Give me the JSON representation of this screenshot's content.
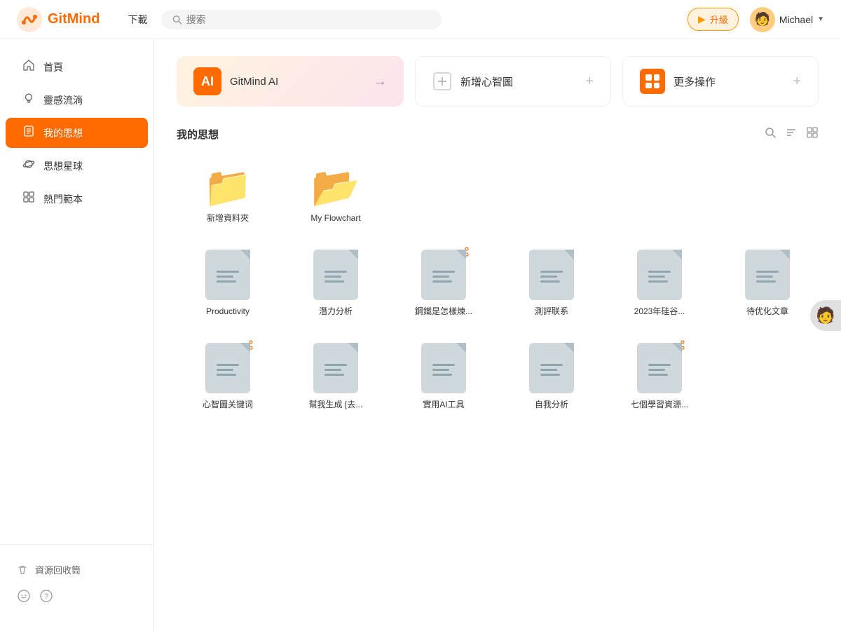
{
  "header": {
    "logo_text": "GitMind",
    "nav_download": "下載",
    "search_placeholder": "搜索",
    "upgrade_label": "升級",
    "user_name": "Michael"
  },
  "sidebar": {
    "items": [
      {
        "id": "home",
        "label": "首頁",
        "icon": "home"
      },
      {
        "id": "inspiration",
        "label": "靈感流淌",
        "icon": "bulb"
      },
      {
        "id": "my-thoughts",
        "label": "我的思想",
        "icon": "doc",
        "active": true
      },
      {
        "id": "planet",
        "label": "思想星球",
        "icon": "planet"
      },
      {
        "id": "templates",
        "label": "熱門範本",
        "icon": "template"
      }
    ],
    "bottom_items": [
      {
        "id": "recycle",
        "label": "資源回收筒",
        "icon": "trash"
      },
      {
        "id": "discord",
        "label": "",
        "icon": "discord"
      },
      {
        "id": "help",
        "label": "",
        "icon": "help"
      }
    ]
  },
  "quick_actions": [
    {
      "id": "gitmind-ai",
      "label": "GitMind AI",
      "type": "ai",
      "icon_text": "AI"
    },
    {
      "id": "new-mindmap",
      "label": "新增心智圖",
      "type": "new"
    },
    {
      "id": "more-actions",
      "label": "更多操作",
      "type": "more"
    }
  ],
  "section": {
    "title": "我的思想",
    "actions": [
      "search",
      "sort",
      "grid"
    ]
  },
  "folders": [
    {
      "id": "new-folder",
      "label": "新增資料夾",
      "color": "#ffa726"
    },
    {
      "id": "my-flowchart",
      "label": "My Flowchart",
      "color": "#ffa726"
    }
  ],
  "files_row1": [
    {
      "id": "productivity",
      "label": "Productivity",
      "shared": false
    },
    {
      "id": "potential-analysis",
      "label": "潛力分析",
      "shared": false
    },
    {
      "id": "steel",
      "label": "鋼鐵是怎樣煉...",
      "shared": true
    },
    {
      "id": "review",
      "label": "測評联系",
      "shared": false
    },
    {
      "id": "silicon-valley",
      "label": "2023年硅谷...",
      "shared": false
    },
    {
      "id": "pending-articles",
      "label": "待优化文章",
      "shared": false
    }
  ],
  "files_row2": [
    {
      "id": "mindmap-keywords",
      "label": "心智圖关键词",
      "shared": true
    },
    {
      "id": "help-generate",
      "label": "幫我生成 [去...",
      "shared": false
    },
    {
      "id": "useful-ai",
      "label": "實用AI工具",
      "shared": false
    },
    {
      "id": "self-analysis",
      "label": "自我分析",
      "shared": false
    },
    {
      "id": "seven-resources",
      "label": "七個學習資源...",
      "shared": true
    }
  ],
  "colors": {
    "primary": "#ff6b00",
    "folder_yellow": "#ffa726",
    "file_gray": "#b0bec5",
    "file_bg": "#cfd8dc"
  }
}
